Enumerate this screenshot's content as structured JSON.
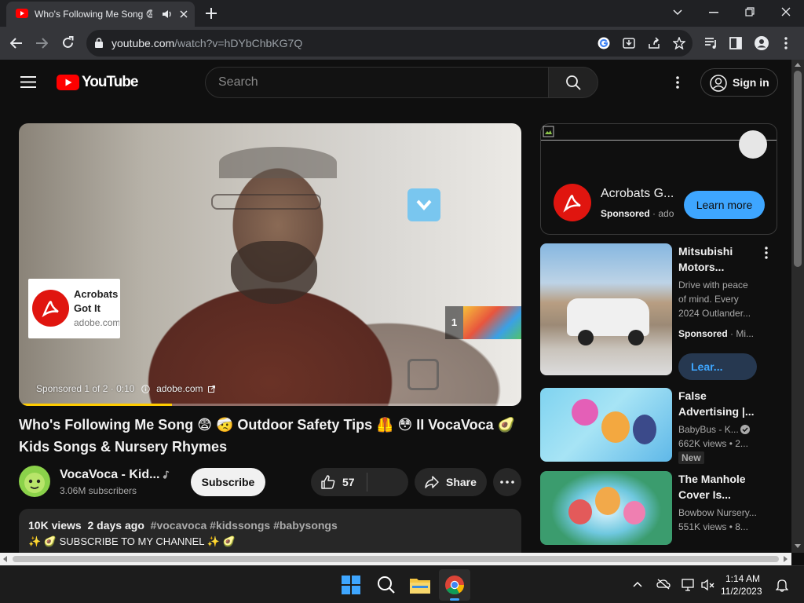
{
  "browser": {
    "tab_title": "Who's Following Me Song 😨",
    "url_host": "youtube.com",
    "url_path": "/watch?v=hDYbChbKG7Q"
  },
  "youtube": {
    "logo_text": "YouTube",
    "search_placeholder": "Search",
    "signin_label": "Sign in"
  },
  "player": {
    "ad_card_title": "Acrobats Got It",
    "ad_card_domain": "adobe.com",
    "ad_queue_count": "1",
    "ad_info": "Sponsored 1 of 2 · 0:10",
    "ad_link": "adobe.com",
    "progress": 0.304
  },
  "video": {
    "title": "Who's Following Me Song 😨 🤕 Outdoor Safety Tips 🦺 😳 II VocaVoca 🥑 Kids Songs & Nursery Rhymes",
    "channel_name": "VocaVoca - Kid...",
    "subscribers": "3.06M subscribers",
    "subscribe_label": "Subscribe",
    "likes": "57",
    "share_label": "Share",
    "views": "10K views",
    "age": "2 days ago",
    "tags": "#vocavoca #kidssongs #babysongs",
    "desc_line": "✨ 🥑 SUBSCRIBE TO MY CHANNEL ✨ 🥑"
  },
  "sidebar": {
    "ad": {
      "title": "Acrobats G...",
      "sponsored": "Sponsored",
      "domain": "· ado",
      "cta": "Learn more"
    },
    "recs": [
      {
        "title": "Mitsubishi Motors...",
        "desc": "Drive with peace of mind. Every 2024 Outlander...",
        "sponsored": "Sponsored",
        "domain": "· Mi...",
        "cta": "Lear..."
      },
      {
        "title": "False Advertising |...",
        "channel": "BabyBus - K...",
        "stats": "662K views • 2...",
        "badge": "New"
      },
      {
        "title": "The Manhole Cover Is...",
        "channel": "Bowbow Nursery...",
        "stats": "551K views • 8..."
      }
    ]
  },
  "taskbar": {
    "time": "1:14 AM",
    "date": "11/2/2023"
  },
  "colors": {
    "youtube_red": "#ff0000",
    "adobe_red": "#e0150f",
    "link_blue": "#3ea6ff",
    "progress_yellow": "#ffcc00"
  }
}
